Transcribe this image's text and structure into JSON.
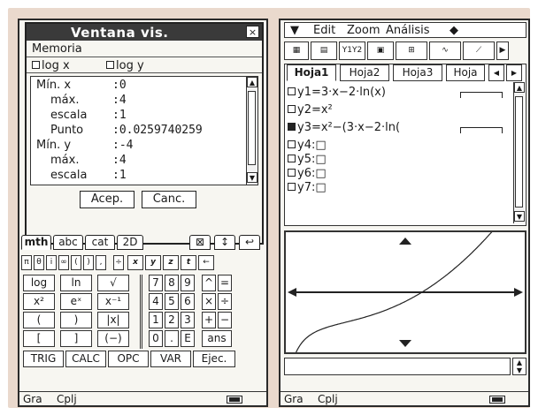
{
  "left": {
    "dialog": {
      "title": "Ventana vis.",
      "close": "×",
      "memoria": "Memoria",
      "log_x": "log x",
      "log_y": "log y",
      "rows": [
        {
          "label": "Mín. x",
          "value": ":0"
        },
        {
          "label": "máx.",
          "value": ":4"
        },
        {
          "label": "escala",
          "value": ":1"
        },
        {
          "label": "Punto",
          "value": ":0.0259740259"
        },
        {
          "label": "Mín. y",
          "value": ":-4"
        },
        {
          "label": "máx.",
          "value": ":4"
        },
        {
          "label": "escala",
          "value": ":1"
        }
      ],
      "accept": "Acep.",
      "cancel": "Canc."
    },
    "keyboard": {
      "tabs": [
        "mth",
        "abc",
        "cat",
        "2D"
      ],
      "tab_icons": [
        "⊠",
        "↕",
        "↩"
      ],
      "symbols": [
        "π",
        "θ",
        "i",
        "∞",
        "(",
        ")",
        ",",
        "÷",
        "x",
        "y",
        "z",
        "t",
        "←"
      ],
      "func_keys": [
        [
          "log",
          "ln",
          "√"
        ],
        [
          "x²",
          "eˣ",
          "x⁻¹"
        ],
        [
          "(",
          ")",
          "|x|"
        ],
        [
          "[",
          "]",
          "(−)"
        ]
      ],
      "num_keys": [
        [
          "7",
          "8",
          "9",
          "^",
          "="
        ],
        [
          "4",
          "5",
          "6",
          "×",
          "÷"
        ],
        [
          "1",
          "2",
          "3",
          "+",
          "−"
        ],
        [
          "0",
          ".",
          "E",
          "ans"
        ]
      ],
      "bottom": [
        "TRIG",
        "CALC",
        "OPC",
        "VAR",
        "Ejec."
      ]
    },
    "status": {
      "gra": "Gra",
      "cplj": "Cplj"
    }
  },
  "right": {
    "menu": {
      "edit": "Edit",
      "zoom": "Zoom",
      "analisis": "Análisis"
    },
    "toolbar_icons": [
      "table-icon",
      "table-split-icon",
      "y1-y2-icon",
      "graph-window-icon",
      "graph-zoom-icon",
      "graph-trace-icon",
      "graph-tangent-icon"
    ],
    "sheet_tabs": [
      "Hoja1",
      "Hoja2",
      "Hoja3",
      "Hoja"
    ],
    "equations": [
      {
        "name": "y1=",
        "expr": "3·x−2·ln(x)",
        "checked": false
      },
      {
        "name": "y2=",
        "expr": "x²",
        "checked": false
      },
      {
        "name": "y3=",
        "expr": "x²−(3·x−2·ln(",
        "checked": true
      },
      {
        "name": "y4:",
        "expr": "□",
        "checked": false
      },
      {
        "name": "y5:",
        "expr": "□",
        "checked": false
      },
      {
        "name": "y6:",
        "expr": "□",
        "checked": false
      },
      {
        "name": "y7:",
        "expr": "□",
        "checked": false
      }
    ],
    "status": {
      "gra": "Gra",
      "cplj": "Cplj"
    }
  }
}
